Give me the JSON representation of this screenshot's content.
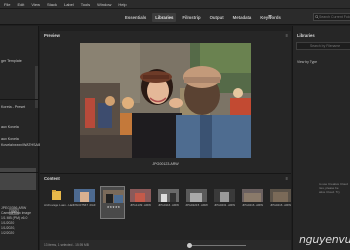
{
  "menu": [
    "File",
    "Edit",
    "View",
    "Stack",
    "Label",
    "Tools",
    "Window",
    "Help"
  ],
  "workspaces": {
    "tabs": [
      "Essentials",
      "Libraries",
      "Filmstrip",
      "Output",
      "Metadata",
      "Keywords"
    ],
    "active_index": 1
  },
  "search": {
    "placeholder": "Search Current Folder"
  },
  "left_panel": {
    "items": [
      "ger Template",
      "Koreta - Preset",
      "aux Kovela",
      "aux Kovela",
      "Kovela/xxxxx/WATHSAIEIE"
    ],
    "metadata_rows": [
      "JPEG0356.ARW",
      "Camera Raw image",
      "1/1 MB (PM) v6.0",
      "1/1/2020",
      "1/1/2020,",
      "1/2/2020"
    ],
    "metadata_badge": "ISO"
  },
  "preview": {
    "title": "Preview",
    "filename": "JPG00123.ARW"
  },
  "content": {
    "title": "Content",
    "thumbnails": [
      {
        "caption": "Archovage Luan...Hart",
        "selected": false
      },
      {
        "caption": "DSC07567 .RAF",
        "selected": false
      },
      {
        "caption": "★★★★★",
        "selected": true
      },
      {
        "caption": "JPG1139 .ARW",
        "selected": false
      },
      {
        "caption": "JPG0116 .ARW",
        "selected": false
      },
      {
        "caption": "JPG02215 .ARW",
        "selected": false
      },
      {
        "caption": "JPG0231 .ARW",
        "selected": false
      },
      {
        "caption": "JPG0216 .ARW",
        "selected": false
      },
      {
        "caption": "JPG0216 .ARW",
        "selected": false
      }
    ],
    "status": "13 items, 1 selected - 15.95 MB"
  },
  "right_panel": {
    "title": "Libraries",
    "search_placeholder": "Search by Filename",
    "view_label": "View by Type",
    "help_text": [
      "to use Creative Cloud",
      "ries, please be",
      "ative Cloud. Try"
    ]
  },
  "watermark": "nguyenvu"
}
